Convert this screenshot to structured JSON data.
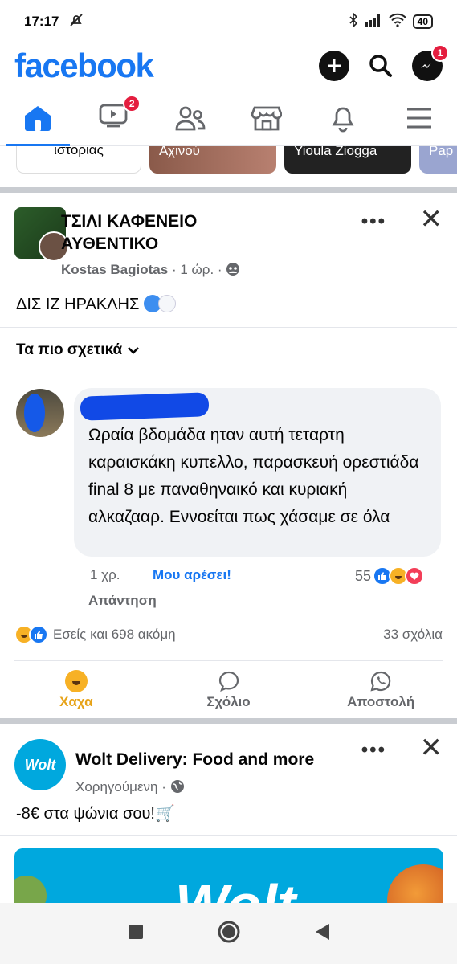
{
  "status_bar": {
    "time": "17:17",
    "battery": "40"
  },
  "header": {
    "logo": "facebook",
    "messenger_badge": "1"
  },
  "tabs": {
    "watch_badge": "2"
  },
  "stories": [
    {
      "label": "ιστορίας"
    },
    {
      "label": "Αχινού"
    },
    {
      "label": "Yioula Ziogga"
    },
    {
      "label": "Pap"
    }
  ],
  "post": {
    "group_name": "ΤΣΙΛΙ ΚΑΦΕΝΕΙΟ ΑΥΘΕΝΤΙΚΟ",
    "author": "Kostas Bagiotas",
    "time": "· 1 ώρ. ·",
    "text": "ΔΙΣ ΙΖ ΗΡΑΚΛΗΣ",
    "sort_label": "Τα πιο σχετικά",
    "comment": {
      "text": "Ωραία βδομάδα ηταν αυτή τεταρτη καραισκάκη κυπελλο, παρασκευή ορεστιάδα final 8 με παναθηναικό και κυριακή αλκαζααρ. Εννοείται πως χάσαμε σε όλα",
      "time": "1 χρ.",
      "like_label": "Μου αρέσει!",
      "reply_label": "Απάντηση",
      "reaction_count": "55"
    },
    "reactions_summary": "Εσείς και 698 ακόμη",
    "comments_count": "33 σχόλια",
    "actions": {
      "react": "Χαχα",
      "comment": "Σχόλιο",
      "share": "Αποστολή"
    }
  },
  "ad": {
    "logo_text": "Wolt",
    "name": "Wolt Delivery: Food and more",
    "sponsored": "Χορηγούμενη ·",
    "text": "-8€ στα ψώνια σου!🛒",
    "image_word": "Wolt"
  },
  "colors": {
    "brand": "#1877f2",
    "haha": "#e7a318",
    "badge": "#e41e3f"
  }
}
